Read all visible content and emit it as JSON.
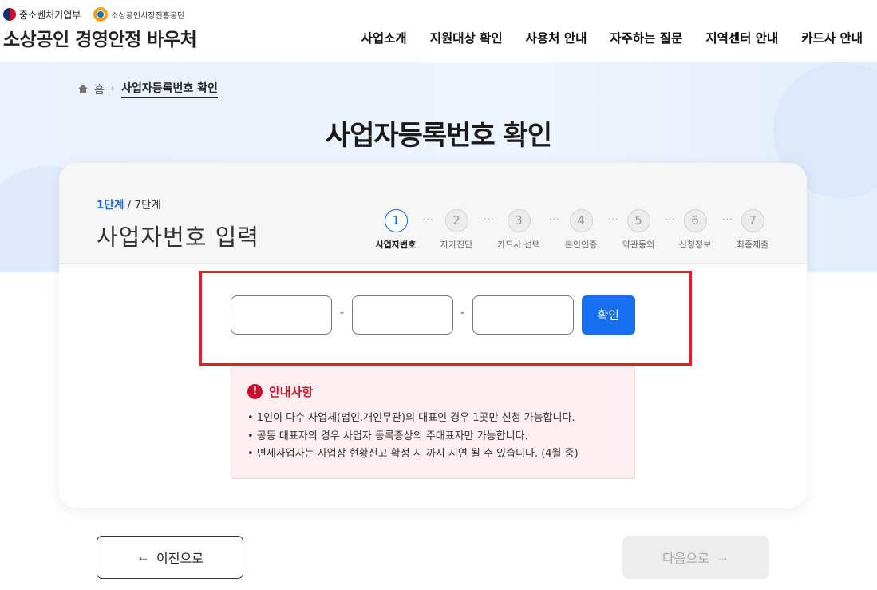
{
  "header": {
    "ministry": "중소벤처기업부",
    "agency": "소상공인시장진흥공단",
    "site_title": "소상공인 경영안정 바우처",
    "nav": [
      "사업소개",
      "지원대상 확인",
      "사용처 안내",
      "자주하는 질문",
      "지역센터 안내",
      "카드사 안내"
    ]
  },
  "breadcrumb": {
    "home": "홈",
    "current": "사업자등록번호 확인"
  },
  "page_title": "사업자등록번호 확인",
  "card": {
    "step_current": "1단계",
    "step_total": " / 7단계",
    "step_title": "사업자번호 입력",
    "steps": [
      {
        "num": "1",
        "label": "사업자번호"
      },
      {
        "num": "2",
        "label": "자가진단"
      },
      {
        "num": "3",
        "label": "카드사 선택"
      },
      {
        "num": "4",
        "label": "본인인증"
      },
      {
        "num": "5",
        "label": "약관동의"
      },
      {
        "num": "6",
        "label": "신청정보"
      },
      {
        "num": "7",
        "label": "최종제출"
      }
    ],
    "active_step": 1
  },
  "form": {
    "part1": "",
    "part2": "",
    "part3": "",
    "dash": "-",
    "confirm_label": "확인"
  },
  "notice": {
    "icon": "!",
    "title": "안내사항",
    "items": [
      "• 1인이 다수 사업체(법인.개인무관)의 대표인 경우 1곳만 신청 가능합니다.",
      "• 공동 대표자의 경우 사업자 등록증상의 주대표자만 가능합니다.",
      "• 면세사업자는 사업장 현황신고 확정 시 까지 지연 될 수 있습니다. (4월 중)"
    ]
  },
  "buttons": {
    "prev_arrow": "←",
    "prev": "이전으로",
    "next": "다음으로",
    "next_arrow": "→"
  },
  "colors": {
    "accent": "#1570ef",
    "alert": "#c8102e",
    "highlight": "#d9232d"
  }
}
